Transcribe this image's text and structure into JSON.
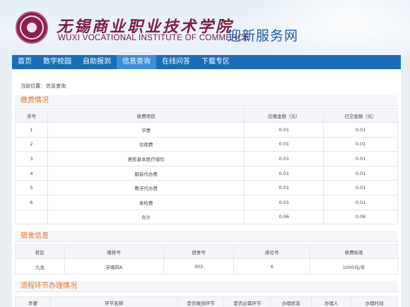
{
  "header": {
    "brand_cn": "无锡商业职业技术学院",
    "brand_en": "WUXI VOCATIONAL INSTITUTE OF COMMERCE",
    "portal_title": "迎新服务网"
  },
  "nav": {
    "items": [
      "首页",
      "数字校园",
      "自助报到",
      "信息查询",
      "在线问答",
      "下载专区"
    ],
    "active_index": 3
  },
  "breadcrumb": {
    "label": "当前位置：",
    "value": "信息查询"
  },
  "fees": {
    "title": "缴费情况",
    "headers": [
      "序号",
      "收费项目",
      "应缴金额（元）",
      "已交金额（元）"
    ],
    "rows": [
      [
        "1",
        "学费",
        "0.01",
        "0.01"
      ],
      [
        "2",
        "住宿费",
        "0.01",
        "0.01"
      ],
      [
        "3",
        "居民基本医疗保险",
        "0.01",
        "0.01"
      ],
      [
        "4",
        "服装代办费",
        "0.01",
        "0.01"
      ],
      [
        "5",
        "教学代办费",
        "0.01",
        "0.01"
      ],
      [
        "6",
        "体检费",
        "0.01",
        "0.01"
      ]
    ],
    "total": {
      "label": "合计",
      "due": "0.06",
      "paid": "0.06"
    }
  },
  "dorm": {
    "title": "宿舍信息",
    "headers": [
      "校区",
      "楼栋号",
      "宿舍号",
      "床位号",
      "收费标准"
    ],
    "row": [
      "九龙",
      "学缘四A",
      "303",
      "6",
      "1000元/年"
    ]
  },
  "process": {
    "title": "流程环节办理情况",
    "headers": [
      "步骤",
      "环节名称",
      "是否报到环节",
      "是否必需环节",
      "办理状态",
      "办理人",
      "办理时间"
    ]
  },
  "colors": {
    "nav_bg": "#1c6db4",
    "nav_active": "#3f8fd6",
    "section_title": "#e27028",
    "brand": "#7b1e43"
  }
}
